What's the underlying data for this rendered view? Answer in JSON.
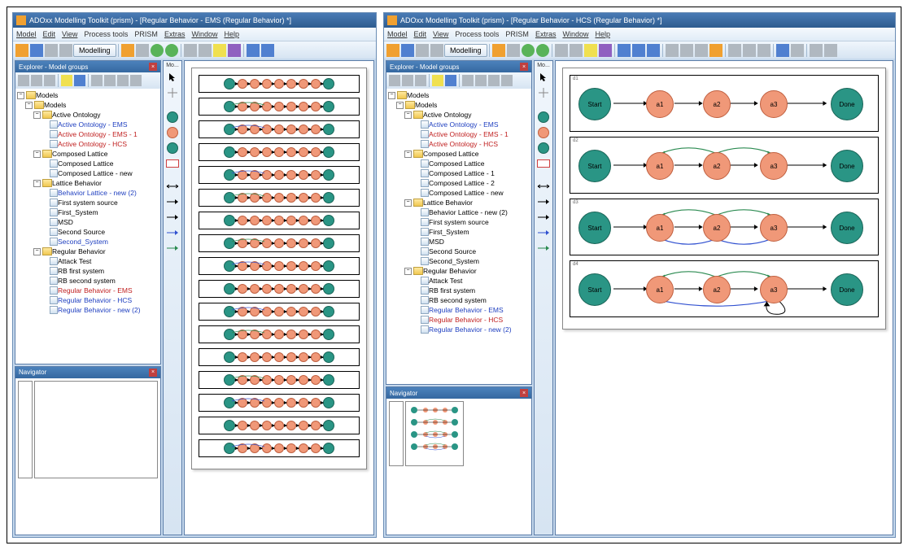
{
  "left_window": {
    "title": "ADOxx Modelling Toolkit (prism) - [Regular Behavior - EMS (Regular Behavior) *]",
    "menu": [
      "Model",
      "Edit",
      "View",
      "Process tools",
      "PRISM",
      "Extras",
      "Window",
      "Help"
    ],
    "modelling_btn": "Modelling",
    "explorer": {
      "title": "Explorer - Model groups",
      "root": "Models",
      "groups": [
        {
          "name": "Active Ontology",
          "items": [
            {
              "label": "Active Ontology - EMS",
              "color": "blue"
            },
            {
              "label": "Active Ontology - EMS - 1",
              "color": "red"
            },
            {
              "label": "Active Ontology - HCS",
              "color": "red"
            }
          ]
        },
        {
          "name": "Composed Lattice",
          "items": [
            {
              "label": "Composed Lattice",
              "color": "black"
            },
            {
              "label": "Composed Lattice - new",
              "color": "black"
            }
          ]
        },
        {
          "name": "Lattice Behavior",
          "items": [
            {
              "label": "Behavior Lattice - new (2)",
              "color": "blue"
            },
            {
              "label": "First system source",
              "color": "black"
            },
            {
              "label": "First_System",
              "color": "black"
            },
            {
              "label": "MSD",
              "color": "black"
            },
            {
              "label": "Second Source",
              "color": "black"
            },
            {
              "label": "Second_System",
              "color": "blue"
            }
          ]
        },
        {
          "name": "Regular Behavior",
          "items": [
            {
              "label": "Attack Test",
              "color": "black"
            },
            {
              "label": "RB first system",
              "color": "black"
            },
            {
              "label": "RB second system",
              "color": "black"
            },
            {
              "label": "Regular Behavior - EMS",
              "color": "red"
            },
            {
              "label": "Regular Behavior - HCS",
              "color": "blue"
            },
            {
              "label": "Regular Behavior - new (2)",
              "color": "blue"
            }
          ]
        }
      ]
    },
    "navigator": {
      "title": "Navigator"
    },
    "palette_label": "Mo...",
    "canvas": {
      "rows": 17,
      "nodes_per_row": 7
    }
  },
  "right_window": {
    "title": "ADOxx Modelling Toolkit (prism) - [Regular Behavior - HCS (Regular Behavior) *]",
    "menu": [
      "Model",
      "Edit",
      "View",
      "Process tools",
      "PRISM",
      "Extras",
      "Window",
      "Help"
    ],
    "modelling_btn": "Modelling",
    "explorer": {
      "title": "Explorer - Model groups",
      "root": "Models",
      "groups": [
        {
          "name": "Active Ontology",
          "items": [
            {
              "label": "Active Ontology - EMS",
              "color": "blue"
            },
            {
              "label": "Active Ontology - EMS - 1",
              "color": "red"
            },
            {
              "label": "Active Ontology - HCS",
              "color": "red"
            }
          ]
        },
        {
          "name": "Composed Lattice",
          "items": [
            {
              "label": "Composed Lattice",
              "color": "black"
            },
            {
              "label": "Composed Lattice - 1",
              "color": "black"
            },
            {
              "label": "Composed Lattice - 2",
              "color": "black"
            },
            {
              "label": "Composed Lattice - new",
              "color": "black"
            }
          ]
        },
        {
          "name": "Lattice Behavior",
          "items": [
            {
              "label": "Behavior Lattice - new (2)",
              "color": "black"
            },
            {
              "label": "First system source",
              "color": "black"
            },
            {
              "label": "First_System",
              "color": "black"
            },
            {
              "label": "MSD",
              "color": "black"
            },
            {
              "label": "Second Source",
              "color": "black"
            },
            {
              "label": "Second_System",
              "color": "black"
            }
          ]
        },
        {
          "name": "Regular Behavior",
          "items": [
            {
              "label": "Attack Test",
              "color": "black"
            },
            {
              "label": "RB first system",
              "color": "black"
            },
            {
              "label": "RB second system",
              "color": "black"
            },
            {
              "label": "Regular Behavior - EMS",
              "color": "blue"
            },
            {
              "label": "Regular Behavior - HCS",
              "color": "red"
            },
            {
              "label": "Regular Behavior - new (2)",
              "color": "blue"
            }
          ]
        }
      ]
    },
    "navigator": {
      "title": "Navigator"
    },
    "palette_label": "Mo...",
    "canvas": {
      "diagrams": [
        {
          "id": "d1",
          "nodes": [
            "Start",
            "a1",
            "a2",
            "a3",
            "Done"
          ],
          "extra_edges": []
        },
        {
          "id": "d2",
          "nodes": [
            "Start",
            "a1",
            "a2",
            "a3",
            "Done"
          ],
          "extra_edges": [
            {
              "from": "a2",
              "to": "a1",
              "color": "green",
              "arc": "top"
            },
            {
              "from": "a2",
              "to": "a3",
              "color": "green",
              "arc": "top"
            }
          ]
        },
        {
          "id": "d3",
          "nodes": [
            "Start",
            "a1",
            "a2",
            "a3",
            "Done"
          ],
          "extra_edges": [
            {
              "from": "a2",
              "to": "a1",
              "color": "green",
              "arc": "top"
            },
            {
              "from": "a2",
              "to": "a3",
              "color": "green",
              "arc": "top"
            },
            {
              "from": "a1",
              "to": "a2",
              "color": "blue",
              "arc": "bottom"
            },
            {
              "from": "a3",
              "to": "a2",
              "color": "blue",
              "arc": "bottom"
            }
          ]
        },
        {
          "id": "d4",
          "nodes": [
            "Start",
            "a1",
            "a2",
            "a3",
            "Done"
          ],
          "extra_edges": [
            {
              "from": "a2",
              "to": "a1",
              "color": "green",
              "arc": "top"
            },
            {
              "from": "a2",
              "to": "a3",
              "color": "green",
              "arc": "top"
            },
            {
              "from": "a3",
              "to": "a1",
              "color": "blue",
              "arc": "bottom"
            },
            {
              "from": "a3",
              "to": "a3",
              "color": "black",
              "arc": "loop"
            }
          ]
        }
      ]
    }
  }
}
